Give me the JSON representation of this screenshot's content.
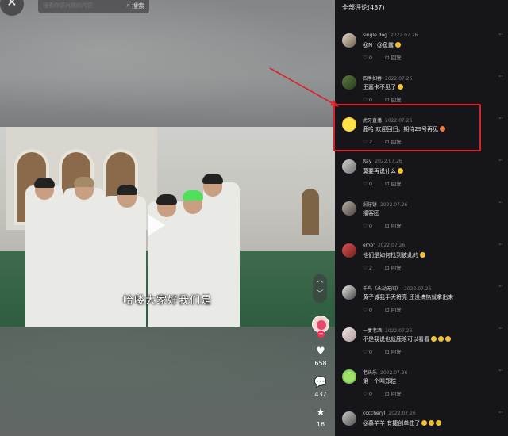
{
  "video": {
    "search": {
      "placeholder": "搜索你感兴趣的内容",
      "button_label": "搜索"
    },
    "subtitle": "哈喽大家好我们是",
    "stats": {
      "likes": "658",
      "comments": "437",
      "favorites": "16"
    },
    "colors": {
      "accent": "#fe2c55"
    }
  },
  "comments": {
    "header": "全部评论(437)",
    "reply_label": "回复",
    "items": [
      {
        "user": "single dog",
        "date": "2022.07.26",
        "text": "@N_  @鱼露",
        "likes": "0"
      },
      {
        "user": "四季如春",
        "date": "2022.07.26",
        "text": "王嘉卡不见了",
        "likes": "0"
      },
      {
        "user": "虎牙直播",
        "date": "2022.07.26",
        "text": "鹿哈  欢迎回归。期待29号再见",
        "likes": "2",
        "highlighted": true
      },
      {
        "user": "Ray",
        "date": "2022.07.26",
        "text": "莫要再说什么",
        "likes": "0"
      },
      {
        "user": "焖仔饼",
        "date": "2022.07.26",
        "text": "播客团",
        "likes": "0"
      },
      {
        "user": "emo'",
        "date": "2022.07.26",
        "text": "他们是如何找到彼此的",
        "likes": "2"
      },
      {
        "user": "千鸟（永劫无间）",
        "date": "2022.07.26",
        "text": "黄子诚我手天将亮 还没搞热就拿出来",
        "likes": "0"
      },
      {
        "user": "一妻老酒",
        "date": "2022.07.26",
        "text": "不是我说也就鹿晗可以看看",
        "likes": "0"
      },
      {
        "user": "老头乐",
        "date": "2022.07.26",
        "text": "第一个叫郑恺",
        "likes": "0"
      },
      {
        "user": "ccccheryl",
        "date": "2022.07.26",
        "text": "@慕羊羊  有捷创单曲了",
        "likes": ""
      }
    ]
  }
}
